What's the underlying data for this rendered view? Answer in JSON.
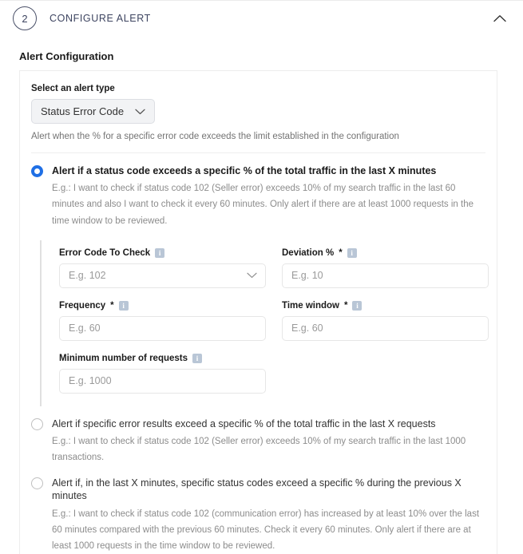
{
  "header": {
    "step_number": "2",
    "title": "CONFIGURE ALERT",
    "collapse_icon": "chevron-up-icon"
  },
  "section": {
    "heading": "Alert Configuration"
  },
  "alert_type": {
    "label": "Select an alert type",
    "selected_value": "Status Error Code",
    "chevron_icon": "chevron-down-icon",
    "hint": "Alert when the % for a specific error code exceeds the limit established in the configuration"
  },
  "options": [
    {
      "selected": true,
      "title": "Alert if a status code exceeds a specific % of the total traffic in the last X minutes",
      "description": "E.g.: I want to check if status code 102 (Seller error) exceeds 10% of my search traffic in the last 60 minutes and also I want to check it every 60 minutes. Only alert if there are at least 1000 requests in the time window to be reviewed."
    },
    {
      "selected": false,
      "title": "Alert if specific error results exceed a specific % of the total traffic in the last X requests",
      "description": "E.g.: I want to check if status code 102 (Seller error) exceeds 10% of my search traffic in the last 1000 transactions."
    },
    {
      "selected": false,
      "title": "Alert if, in the last X minutes, specific status codes exceed a specific % during the previous X minutes",
      "description": "E.g.: I want to check if status code 102 (communication error) has increased by at least 10% over the last 60 minutes compared with the previous 60 minutes. Check it every 60 minutes. Only alert if there are at least 1000 requests in the time window to be reviewed."
    }
  ],
  "fields": {
    "error_code": {
      "label": "Error Code To Check",
      "required_marker": "",
      "info_icon": "info-icon",
      "placeholder": "E.g. 102",
      "value": "",
      "chevron_icon": "chevron-down-icon"
    },
    "deviation": {
      "label": "Deviation %",
      "required_marker": "*",
      "info_icon": "info-icon",
      "placeholder": "E.g. 10",
      "value": ""
    },
    "frequency": {
      "label": "Frequency",
      "required_marker": "*",
      "info_icon": "info-icon",
      "placeholder": "E.g. 60",
      "value": ""
    },
    "time_window": {
      "label": "Time window",
      "required_marker": "*",
      "info_icon": "info-icon",
      "placeholder": "E.g. 60",
      "value": ""
    },
    "min_requests": {
      "label": "Minimum number of requests",
      "required_marker": "",
      "info_icon": "info-icon",
      "placeholder": "E.g. 1000",
      "value": ""
    }
  },
  "colors": {
    "accent_blue": "#1f6fe5",
    "badge_navy": "#3d4460",
    "info_icon_bg": "#b9c6d6",
    "border_grey": "#ededed",
    "muted_text": "#8c8c8c"
  }
}
